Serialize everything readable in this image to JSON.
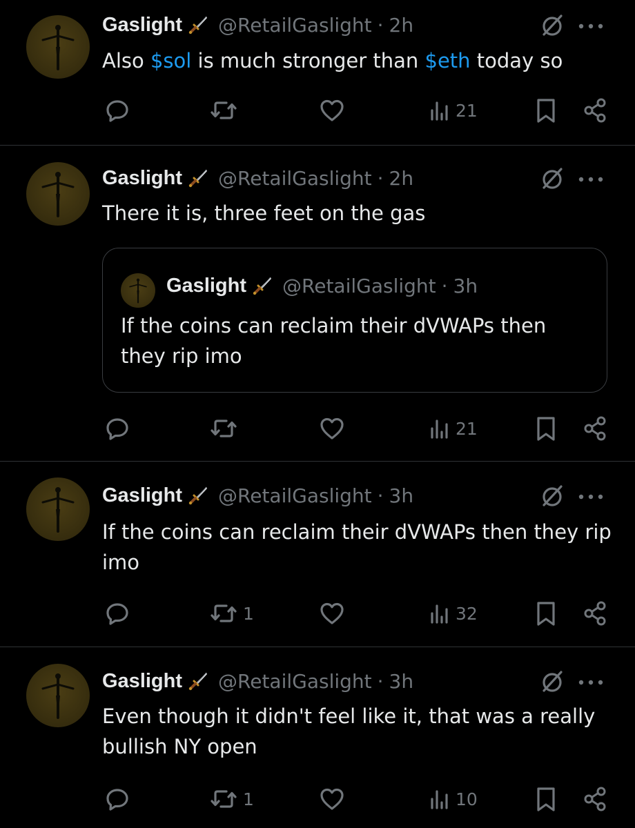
{
  "colors": {
    "background": "#000000",
    "text": "#e7e9ea",
    "muted": "#71767b",
    "link": "#1d9bf0",
    "divider": "#2f3336"
  },
  "tweets": [
    {
      "name": "Gaslight",
      "handle": "@RetailGaslight",
      "dot": "·",
      "time": "2h",
      "text_parts": [
        "Also ",
        "$sol",
        " is much stronger than ",
        "$eth",
        " today so"
      ],
      "replies": "",
      "reposts": "",
      "likes": "",
      "views": "21"
    },
    {
      "name": "Gaslight",
      "handle": "@RetailGaslight",
      "dot": "·",
      "time": "2h",
      "text": "There it is, three feet on the gas",
      "quote": {
        "name": "Gaslight",
        "handle": "@RetailGaslight",
        "dot": "·",
        "time": "3h",
        "text": "If the coins can reclaim their dVWAPs then they rip imo"
      },
      "replies": "",
      "reposts": "",
      "likes": "",
      "views": "21"
    },
    {
      "name": "Gaslight",
      "handle": "@RetailGaslight",
      "dot": "·",
      "time": "3h",
      "text": "If the coins can reclaim their dVWAPs then they rip imo",
      "replies": "",
      "reposts": "1",
      "likes": "",
      "views": "32"
    },
    {
      "name": "Gaslight",
      "handle": "@RetailGaslight",
      "dot": "·",
      "time": "3h",
      "text": "Even though it didn't feel like it, that was a really bullish NY open",
      "replies": "",
      "reposts": "1",
      "likes": "",
      "views": "10"
    }
  ],
  "icons": {
    "avatar": "avatar-image",
    "badge": "dagger-icon",
    "grok": "grok-icon",
    "more": "more-icon",
    "reply": "reply-icon",
    "repost": "repost-icon",
    "like": "like-icon",
    "views": "views-icon",
    "bookmark": "bookmark-icon",
    "share": "share-icon"
  }
}
